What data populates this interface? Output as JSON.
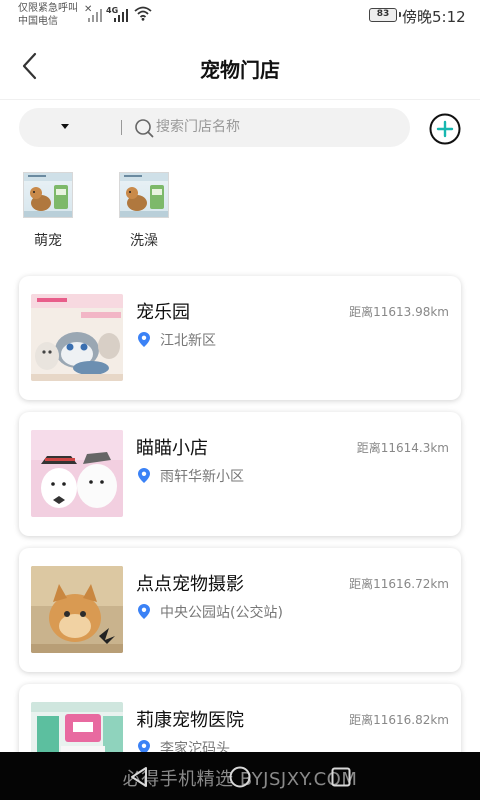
{
  "status_bar": {
    "line1": "仅限紧急呼叫",
    "line2": "中国电信",
    "network": "4G",
    "battery": "83",
    "time": "傍晚5:12"
  },
  "header": {
    "title": "宠物门店"
  },
  "search": {
    "placeholder": "搜索门店名称",
    "value": ""
  },
  "categories": [
    {
      "label": "萌宠"
    },
    {
      "label": "洗澡"
    }
  ],
  "stores": [
    {
      "name": "宠乐园",
      "distance": "距离11613.98km",
      "location": "江北新区"
    },
    {
      "name": "瞄瞄小店",
      "distance": "距离11614.3km",
      "location": "雨轩华新小区"
    },
    {
      "name": "点点宠物摄影",
      "distance": "距离11616.72km",
      "location": "中央公园站(公交站)"
    },
    {
      "name": "莉康宠物医院",
      "distance": "距离11616.82km",
      "location": "李家沱码头"
    }
  ],
  "watermark": "必得手机精选 BYJSJXY.COM",
  "colors": {
    "accent": "#17b7b0",
    "pin": "#3b82f6",
    "nav_bg": "#050505"
  },
  "icons": [
    "back-arrow-icon",
    "chevron-down-icon",
    "search-icon",
    "add-circle-icon",
    "location-pin-icon",
    "back-triangle-icon",
    "home-circle-icon",
    "recents-square-icon"
  ]
}
